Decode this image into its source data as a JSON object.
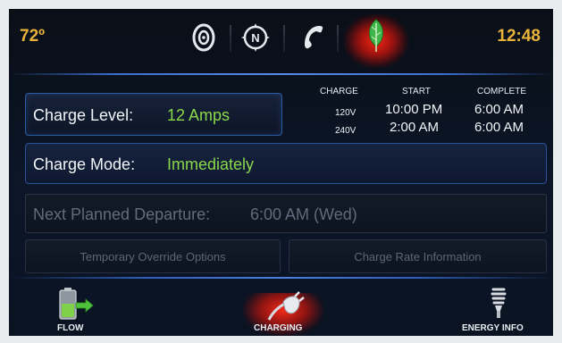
{
  "status": {
    "temperature": "72º",
    "time": "12:48"
  },
  "top_icons": [
    "audio-icon",
    "navigation-icon",
    "phone-icon",
    "leaf-icon"
  ],
  "charge_level": {
    "label": "Charge Level:",
    "value": "12 Amps"
  },
  "schedule": {
    "headers": {
      "charge": "CHARGE",
      "start": "START",
      "complete": "COMPLETE"
    },
    "rows": [
      {
        "voltage": "120V",
        "start": "10:00 PM",
        "complete": "6:00 AM"
      },
      {
        "voltage": "240V",
        "start": "2:00 AM",
        "complete": "6:00 AM"
      }
    ]
  },
  "charge_mode": {
    "label": "Charge Mode:",
    "value": "Immediately"
  },
  "departure": {
    "label": "Next Planned Departure:",
    "value": "6:00 AM (Wed)"
  },
  "buttons": {
    "override": "Temporary Override Options",
    "rate_info": "Charge Rate Information"
  },
  "nav": {
    "flow": "FLOW",
    "charging": "CHARGING",
    "energy": "ENERGY INFO",
    "active": "CHARGING"
  },
  "colors": {
    "status_amber": "#e9b23b",
    "value_green": "#8bd84b",
    "active_red": "#e0201a",
    "accent_blue": "#2d5aa8"
  }
}
